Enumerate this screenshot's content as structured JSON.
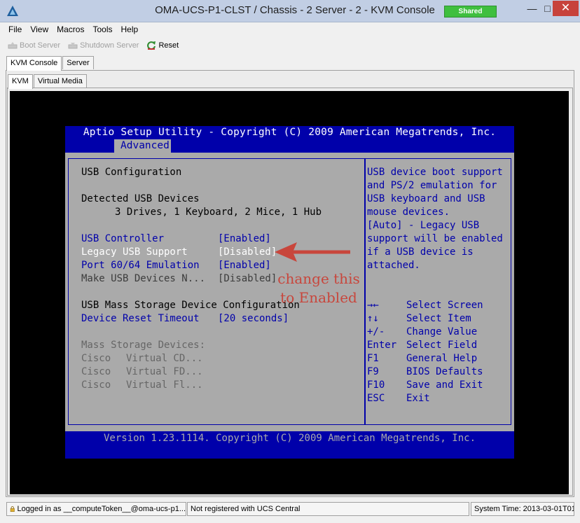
{
  "window": {
    "title": "OMA-UCS-P1-CLST /  Chassis - 2 Server - 2 - KVM Console",
    "shared_badge": "Shared",
    "colors": {
      "titlebar": "#c1cee4",
      "close": "#c7423b",
      "shared": "#3fbf3f"
    }
  },
  "menu": [
    "File",
    "View",
    "Macros",
    "Tools",
    "Help"
  ],
  "toolbar": {
    "boot_server": "Boot Server",
    "shutdown_server": "Shutdown Server",
    "reset": "Reset"
  },
  "tabs_top": [
    "KVM Console",
    "Server"
  ],
  "tabs_sub": [
    "KVM",
    "Virtual Media"
  ],
  "bios": {
    "title": "Aptio Setup Utility - Copyright (C) 2009 American Megatrends, Inc.",
    "active_tab": "Advanced",
    "section_title": "USB Configuration",
    "detected_label": "Detected USB Devices",
    "detected_value": "3 Drives, 1 Keyboard, 2 Mice, 1 Hub",
    "settings": [
      {
        "label": "USB Controller",
        "value": "[Enabled]"
      },
      {
        "label": "Legacy USB Support",
        "value": "[Disabled]"
      },
      {
        "label": "Port 60/64 Emulation",
        "value": "[Enabled]"
      },
      {
        "label": "Make USB Devices N...",
        "value": "[Disabled]"
      }
    ],
    "mass_storage_config": "USB Mass Storage Device Configuration",
    "device_reset": {
      "label": "Device Reset Timeout",
      "value": "[20 seconds]"
    },
    "mass_storage_devices_label": "Mass Storage Devices:",
    "devices": [
      {
        "vendor": "Cisco",
        "name": "Virtual CD..."
      },
      {
        "vendor": "Cisco",
        "name": "Virtual FD..."
      },
      {
        "vendor": "Cisco",
        "name": "Virtual Fl..."
      }
    ],
    "help_lines": [
      "USB device boot support",
      "and PS/2 emulation for",
      "USB keyboard and USB",
      "mouse devices.",
      "[Auto] - Legacy USB",
      "support will be enabled",
      "if a USB device is",
      "attached."
    ],
    "keys": [
      {
        "key": "→←",
        "action": "Select Screen"
      },
      {
        "key": "↑↓",
        "action": "Select Item"
      },
      {
        "key": "+/-",
        "action": "Change Value"
      },
      {
        "key": "Enter",
        "action": "Select Field"
      },
      {
        "key": "F1",
        "action": "General Help"
      },
      {
        "key": "F9",
        "action": "BIOS Defaults"
      },
      {
        "key": "F10",
        "action": "Save and Exit"
      },
      {
        "key": "ESC",
        "action": "Exit"
      }
    ],
    "version": "Version 1.23.1114. Copyright (C) 2009 American Megatrends, Inc.",
    "colors": {
      "blue": "#0000aa",
      "grey": "#aaaaaa",
      "white": "#ffffff"
    }
  },
  "annotation": {
    "line1": "change this",
    "line2": "to Enabled",
    "color": "#c8463c"
  },
  "status": {
    "login": "Logged in as __computeToken__@oma-ucs-p1...",
    "registration": "Not registered with UCS Central",
    "system_time": "System Time: 2013-03-01T01"
  }
}
